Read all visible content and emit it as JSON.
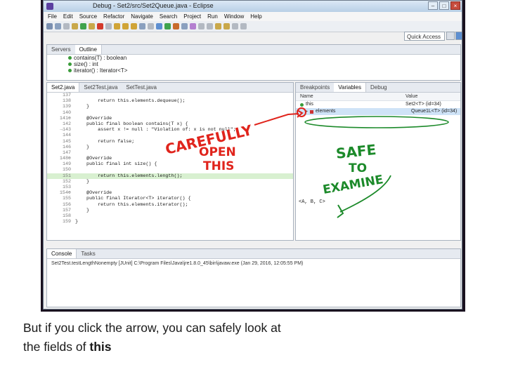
{
  "window": {
    "title": "Debug - Set2/src/Set2Queue.java - Eclipse"
  },
  "menu": [
    "File",
    "Edit",
    "Source",
    "Refactor",
    "Navigate",
    "Search",
    "Project",
    "Run",
    "Window",
    "Help"
  ],
  "quick_access": {
    "placeholder": "Quick Access"
  },
  "outline": {
    "tabs": [
      {
        "label": "Servers"
      },
      {
        "label": "Outline"
      }
    ],
    "items": [
      {
        "label": "contains(T) : boolean"
      },
      {
        "label": "size() : int"
      },
      {
        "label": "iterator() : Iterator<T>"
      }
    ]
  },
  "editor": {
    "tabs": [
      {
        "label": "Set2.java"
      },
      {
        "label": "Set2Test.java"
      },
      {
        "label": "SetTest.java"
      }
    ],
    "lines": [
      {
        "num": "137",
        "text": ""
      },
      {
        "num": "138",
        "text": "        return this.elements.dequeue();"
      },
      {
        "num": "139",
        "text": "    }"
      },
      {
        "num": "140",
        "text": ""
      },
      {
        "num": "141⊕",
        "text": "    @Override"
      },
      {
        "num": "142",
        "text": "    public final boolean contains(T x) {"
      },
      {
        "num": "→143",
        "text": "        assert x != null : \"Violation of: x is not null\";"
      },
      {
        "num": "144",
        "text": ""
      },
      {
        "num": "145",
        "text": "        return false;"
      },
      {
        "num": "146",
        "text": "    }"
      },
      {
        "num": "147",
        "text": ""
      },
      {
        "num": "148⊕",
        "text": "    @Override"
      },
      {
        "num": "149",
        "text": "    public final int size() {"
      },
      {
        "num": "150",
        "text": ""
      },
      {
        "num": "151",
        "text": "        return this.elements.length();"
      },
      {
        "num": "152",
        "text": "    }"
      },
      {
        "num": "153",
        "text": ""
      },
      {
        "num": "154⊕",
        "text": "    @Override"
      },
      {
        "num": "155",
        "text": "    public final Iterator<T> iterator() {"
      },
      {
        "num": "156",
        "text": "        return this.elements.iterator();"
      },
      {
        "num": "157",
        "text": "    }"
      },
      {
        "num": "158",
        "text": ""
      },
      {
        "num": "159",
        "text": "}"
      }
    ]
  },
  "variables": {
    "tabs": [
      {
        "label": "Breakpoints"
      },
      {
        "label": "Variables"
      },
      {
        "label": "Debug"
      }
    ],
    "col_name": "Name",
    "col_value": "Value",
    "rows": [
      {
        "name": "this",
        "value": "Set2<T> (id=34)"
      },
      {
        "name": "elements",
        "value": "Queue1L<T> (id=34)"
      }
    ],
    "detail": "<A, B, C>"
  },
  "console": {
    "tabs": [
      {
        "label": "Console"
      },
      {
        "label": "Tasks"
      }
    ],
    "text": "Set2Test.testLengthNonempty [JUnit] C:\\Program Files\\Java\\jre1.8.0_45\\bin\\javaw.exe (Jan 29, 2016, 12:05:55 PM)"
  },
  "annotations": {
    "carefully_1": "CAREFULLY",
    "carefully_2": "OPEN",
    "carefully_3": "THIS",
    "safe_1": "SAFE",
    "safe_2": "TO",
    "safe_3": "EXAMINE",
    "red_color": "#e0241c",
    "green_color": "#1c8a2a"
  },
  "caption": {
    "line1": "But if you click the arrow, you can safely look at",
    "line2_prefix": "the fields of ",
    "line2_bold": "this"
  }
}
